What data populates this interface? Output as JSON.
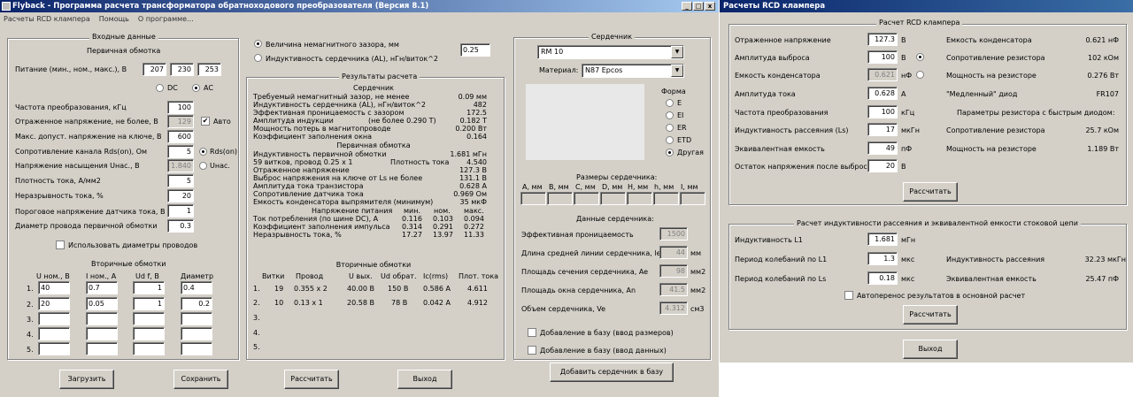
{
  "main": {
    "title": "Flyback - Программа расчета трансформатора обратноходового преобразователя (Версия 8.1)",
    "controls": [
      "_",
      "□",
      "x"
    ],
    "menu": [
      "Расчеты RCD клампера",
      "Помощь",
      "О программе..."
    ]
  },
  "input": {
    "group": "Входные данные",
    "primary": "Первичная обмотка",
    "supply_label": "Питание (мин., ном., макс.), В",
    "supply": [
      "207",
      "230",
      "253"
    ],
    "dc": "DC",
    "ac": "AC",
    "rows": [
      {
        "label": "Частота преобразования, кГц",
        "value": "100"
      },
      {
        "label": "Отраженное напряжение, не более, В",
        "value": "129",
        "extra": "Авто"
      },
      {
        "label": "Макс. допуст. напряжение на ключе, В",
        "value": "600"
      },
      {
        "label": "Сопротивление канала Rds(on), Ом",
        "value": "5",
        "extra": "Rds(on)"
      },
      {
        "label": "Напряжение насыщения Uнас., В",
        "value": "1.840",
        "extra": "Uнас."
      },
      {
        "label": "Плотность тока, А/мм2",
        "value": "5"
      },
      {
        "label": "Неразрывность тока, %",
        "value": "20"
      },
      {
        "label": "Пороговое напряжение датчика тока, В",
        "value": "1"
      },
      {
        "label": "Диаметр провода первичной обмотки",
        "value": "0.3"
      }
    ],
    "use_diam": "Использовать диаметры проводов",
    "secondary": "Вторичные обмотки",
    "sec_headers": [
      "U ном., В",
      "I ном., А",
      "Ud f, В",
      "Диаметр"
    ],
    "sec_rows": [
      {
        "n": "1.",
        "v": [
          "40",
          "0.7",
          "1",
          "0.4"
        ]
      },
      {
        "n": "2.",
        "v": [
          "20",
          "0.05",
          "1",
          "0.2"
        ]
      },
      {
        "n": "3.",
        "v": [
          "",
          "",
          "",
          ""
        ]
      },
      {
        "n": "4.",
        "v": [
          "",
          "",
          "",
          ""
        ]
      },
      {
        "n": "5.",
        "v": [
          "",
          "",
          "",
          ""
        ]
      }
    ]
  },
  "gap": {
    "opt1": "Величина немагнитного зазора, мм",
    "opt2": "Индуктивность сердечника (AL), нГн/виток^2",
    "value": "0.25"
  },
  "results": {
    "group": "Результаты расчета",
    "core_title": "Сердечник",
    "core": [
      {
        "l": "Требуемый немагнитный зазор, не менее",
        "v": "0.09 мм"
      },
      {
        "l": "Индуктивность сердечника (AL), нГн/виток^2",
        "v": "482"
      },
      {
        "l": "Эффективная проницаемость с зазором",
        "v": "172.5"
      },
      {
        "l": "Амплитуда индукции",
        "m": "(не более 0.290 Т)",
        "v": "0.182 Т"
      },
      {
        "l": "Мощность потерь в магнитопроводе",
        "v": "0.200 Вт"
      },
      {
        "l": "Коэффициент заполнения окна",
        "v": "0.164"
      }
    ],
    "prim_title": "Первичная обмотка",
    "prim": [
      {
        "l": "Индуктивность первичной обмотки",
        "v": "1.681 мГн"
      },
      {
        "l": " 59 витков, провод 0.25 x 1",
        "m": "Плотность тока",
        "v": "4.540"
      },
      {
        "l": "Отраженное напряжение",
        "v": "127.3 В"
      },
      {
        "l": "Выброс напряжения на ключе от Ls не более",
        "v": "131.1 В"
      },
      {
        "l": "Амплитуда тока транзистора",
        "v": "0.628 А"
      },
      {
        "l": "Сопротивление датчика тока",
        "v": "0.969 Ом"
      },
      {
        "l": "Емкость конденсатора выпрямителя (минимум)",
        "v": "35 мкФ"
      }
    ],
    "supply_hdr": [
      "Напряжение питания",
      "мин.",
      "ном.",
      "макс."
    ],
    "supply_rows": [
      {
        "l": "Ток потребления (по шине DC), А",
        "v": [
          "0.116",
          "0.103",
          "0.094"
        ]
      },
      {
        "l": "Коэффициент заполнения импульса",
        "v": [
          "0.314",
          "0.291",
          "0.272"
        ]
      },
      {
        "l": "Неразрывность тока, %",
        "v": [
          "17.27",
          "13.97",
          "11.33"
        ]
      }
    ],
    "sec_title": "Вторичные обмотки",
    "sec_hdr": [
      "Витки",
      "Провод",
      "U вых.",
      "Ud обрат.",
      "Ic(rms)",
      "Плот. тока"
    ],
    "sec_rows": [
      {
        "n": "1.",
        "v": [
          "19",
          "0.355 x 2",
          "40.00 В",
          "150 В",
          "0.586 А",
          "4.611"
        ]
      },
      {
        "n": "2.",
        "v": [
          "10",
          "0.13 x 1",
          "20.58 В",
          "78 В",
          "0.042 А",
          "4.912"
        ]
      },
      {
        "n": "3.",
        "v": [
          "",
          "",
          "",
          "",
          "",
          ""
        ]
      },
      {
        "n": "4.",
        "v": [
          "",
          "",
          "",
          "",
          "",
          ""
        ]
      },
      {
        "n": "5.",
        "v": [
          "",
          "",
          "",
          "",
          "",
          ""
        ]
      }
    ]
  },
  "core": {
    "group": "Сердечник",
    "model": "RM 10",
    "mat_label": "Материал:",
    "material": "N87 Epcos",
    "shape_label": "Форма",
    "shapes": [
      "E",
      "EI",
      "ER",
      "ETD",
      "Другая"
    ],
    "dims_title": "Размеры сердечника:",
    "dims": [
      "A, мм",
      "B, мм",
      "C, мм",
      "D, мм",
      "H, мм",
      "h, мм",
      "I, мм"
    ],
    "data_title": "Данные сердечника:",
    "data": [
      {
        "l": "Эффективная проницаемость",
        "v": "1500",
        "u": ""
      },
      {
        "l": "Длина средней линии сердечника, le",
        "v": "44",
        "u": "мм"
      },
      {
        "l": "Площадь сечения сердечника, Ae",
        "v": "98",
        "u": "мм2"
      },
      {
        "l": "Площадь окна сердечника, An",
        "v": "41.5",
        "u": "мм2"
      },
      {
        "l": "Объем сердечника, Ve",
        "v": "4.312",
        "u": "см3"
      }
    ],
    "add1": "Добавление в базу (ввод размеров)",
    "add2": "Добавление в базу (ввод данных)",
    "add_btn": "Добавить сердечник в базу"
  },
  "buttons": {
    "load": "Загрузить",
    "save": "Сохранить",
    "calc": "Рассчитать",
    "exit": "Выход"
  },
  "rcd": {
    "title": "Расчеты RCD клампера",
    "group": "Расчет RCD клампера",
    "rows": [
      {
        "l": "Отраженное напряжение",
        "v": "127.3",
        "u": "В",
        "rl": "Емкость конденсатора",
        "rv": "0.621 нФ"
      },
      {
        "l": "Амплитуда выброса",
        "v": "100",
        "u": "В",
        "rl": "Сопротивление резистора",
        "rv": "102 кОм"
      },
      {
        "l": "Емкость конденсатора",
        "v": "0.621",
        "u": "нФ",
        "rl": "Мощность на резисторе",
        "rv": "0.276 Вт"
      },
      {
        "l": "Амплитуда тока",
        "v": "0.628",
        "u": "А",
        "rl": "\"Медленный\" диод",
        "rv": "FR107"
      },
      {
        "l": "Частота преобразования",
        "v": "100",
        "u": "кГц",
        "rl": "Параметры резистора с быстрым диодом:",
        "rv": ""
      },
      {
        "l": "Индуктивность рассеяния (Ls)",
        "v": "17",
        "u": "мкГн",
        "rl": "Сопротивление резистора",
        "rv": "25.7 кОм"
      },
      {
        "l": "Эквивалентная емкость",
        "v": "49",
        "u": "пФ",
        "rl": "Мощность на резисторе",
        "rv": "1.189 Вт"
      },
      {
        "l": "Остаток напряжения после выброса",
        "v": "20",
        "u": "В",
        "rl": "",
        "rv": ""
      }
    ],
    "calc": "Рассчитать",
    "group2": "Расчет индуктивности рассеяния и эквивалентной емкости стоковой цепи",
    "rows2": [
      {
        "l": "Индуктивность L1",
        "v": "1.681",
        "u": "мГн",
        "rl": "",
        "rv": ""
      },
      {
        "l": "Период колебаний по L1",
        "v": "1.3",
        "u": "мкс",
        "rl": "Индуктивность рассеяния",
        "rv": "32.23 мкГн"
      },
      {
        "l": "Период колебаний по Ls",
        "v": "0.18",
        "u": "мкс",
        "rl": "Эквивалентная емкость",
        "rv": "25.47 пФ"
      }
    ],
    "auto": "Автоперенос результатов в основной расчет",
    "calc2": "Рассчитать",
    "exit": "Выход"
  }
}
